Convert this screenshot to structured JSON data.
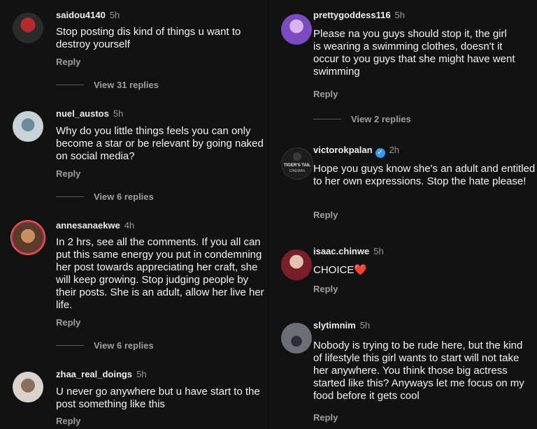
{
  "left": [
    {
      "username": "saidou4140",
      "time": "5h",
      "text": "Stop posting dis kind of things u want to destroy yourself",
      "reply": "Reply",
      "view_replies": "View 31 replies",
      "avatar": {
        "icon": "profile-photo",
        "colors": [
          "#2b2b2b",
          "#b52a2a"
        ]
      }
    },
    {
      "username": "nuel_austos",
      "time": "5h",
      "text": "Why do you little things feels you can only become a star or be relevant by going naked on social media?",
      "reply": "Reply",
      "view_replies": "View 6 replies",
      "avatar": {
        "icon": "profile-photo",
        "colors": [
          "#c9d2d6",
          "#6b8c9a"
        ]
      }
    },
    {
      "username": "annesanaekwe",
      "time": "4h",
      "text": "In 2 hrs, see all the comments. If you all can put this same energy you put in condemning her post towards appreciating her craft, she will keep growing. Stop judging people by their posts. She is an adult, allow her live her life.",
      "reply": "Reply",
      "view_replies": "View 6 replies",
      "avatar": {
        "icon": "profile-photo-story-ring",
        "colors": [
          "#5a3b2a",
          "#c98f60"
        ]
      }
    },
    {
      "username": "zhaa_real_doings",
      "time": "5h",
      "text": "U never go anywhere but u have start to the post something like this",
      "reply": "Reply",
      "avatar": {
        "icon": "profile-photo",
        "colors": [
          "#d9d3cc",
          "#8a6f5c"
        ]
      }
    }
  ],
  "right": [
    {
      "username": "prettygoddess116",
      "time": "5h",
      "text": "Please na you guys should stop it, the girl is wearing a swimming clothes, doesn't it occur to you guys that she might have went swimming",
      "reply": "Reply",
      "view_replies": "View 2 replies",
      "avatar": {
        "icon": "profile-photo",
        "colors": [
          "#7b4bbf",
          "#d8b4f2"
        ]
      }
    },
    {
      "username": "victorokpalan",
      "time": "2h",
      "verified": true,
      "text": "Hope you guys know she's an adult and entitled to her own expressions. Stop the hate please!",
      "reply": "Reply",
      "avatar": {
        "icon": "tigers-tail-cinemas-logo",
        "colors": [
          "#1d1d1d",
          "#e8e8e8"
        ],
        "label_top": "TIGER'S TAIL",
        "label_bottom": "CINEMAS"
      }
    },
    {
      "username": "isaac.chinwe",
      "time": "5h",
      "text": "CHOICE",
      "emoji": "❤️",
      "reply": "Reply",
      "avatar": {
        "icon": "profile-photo",
        "colors": [
          "#7a1f2a",
          "#e0c3b0"
        ]
      }
    },
    {
      "username": "slytimnim",
      "time": "5h",
      "text": "Nobody is trying to be rude here, but the kind of lifestyle this girl wants to start will not take her anywhere. You think those big actress started like this? Anyways let me focus on my food before it gets cool",
      "reply": "Reply",
      "avatar": {
        "icon": "profile-photo",
        "colors": [
          "#6b6e74",
          "#2c2e33"
        ]
      }
    }
  ]
}
